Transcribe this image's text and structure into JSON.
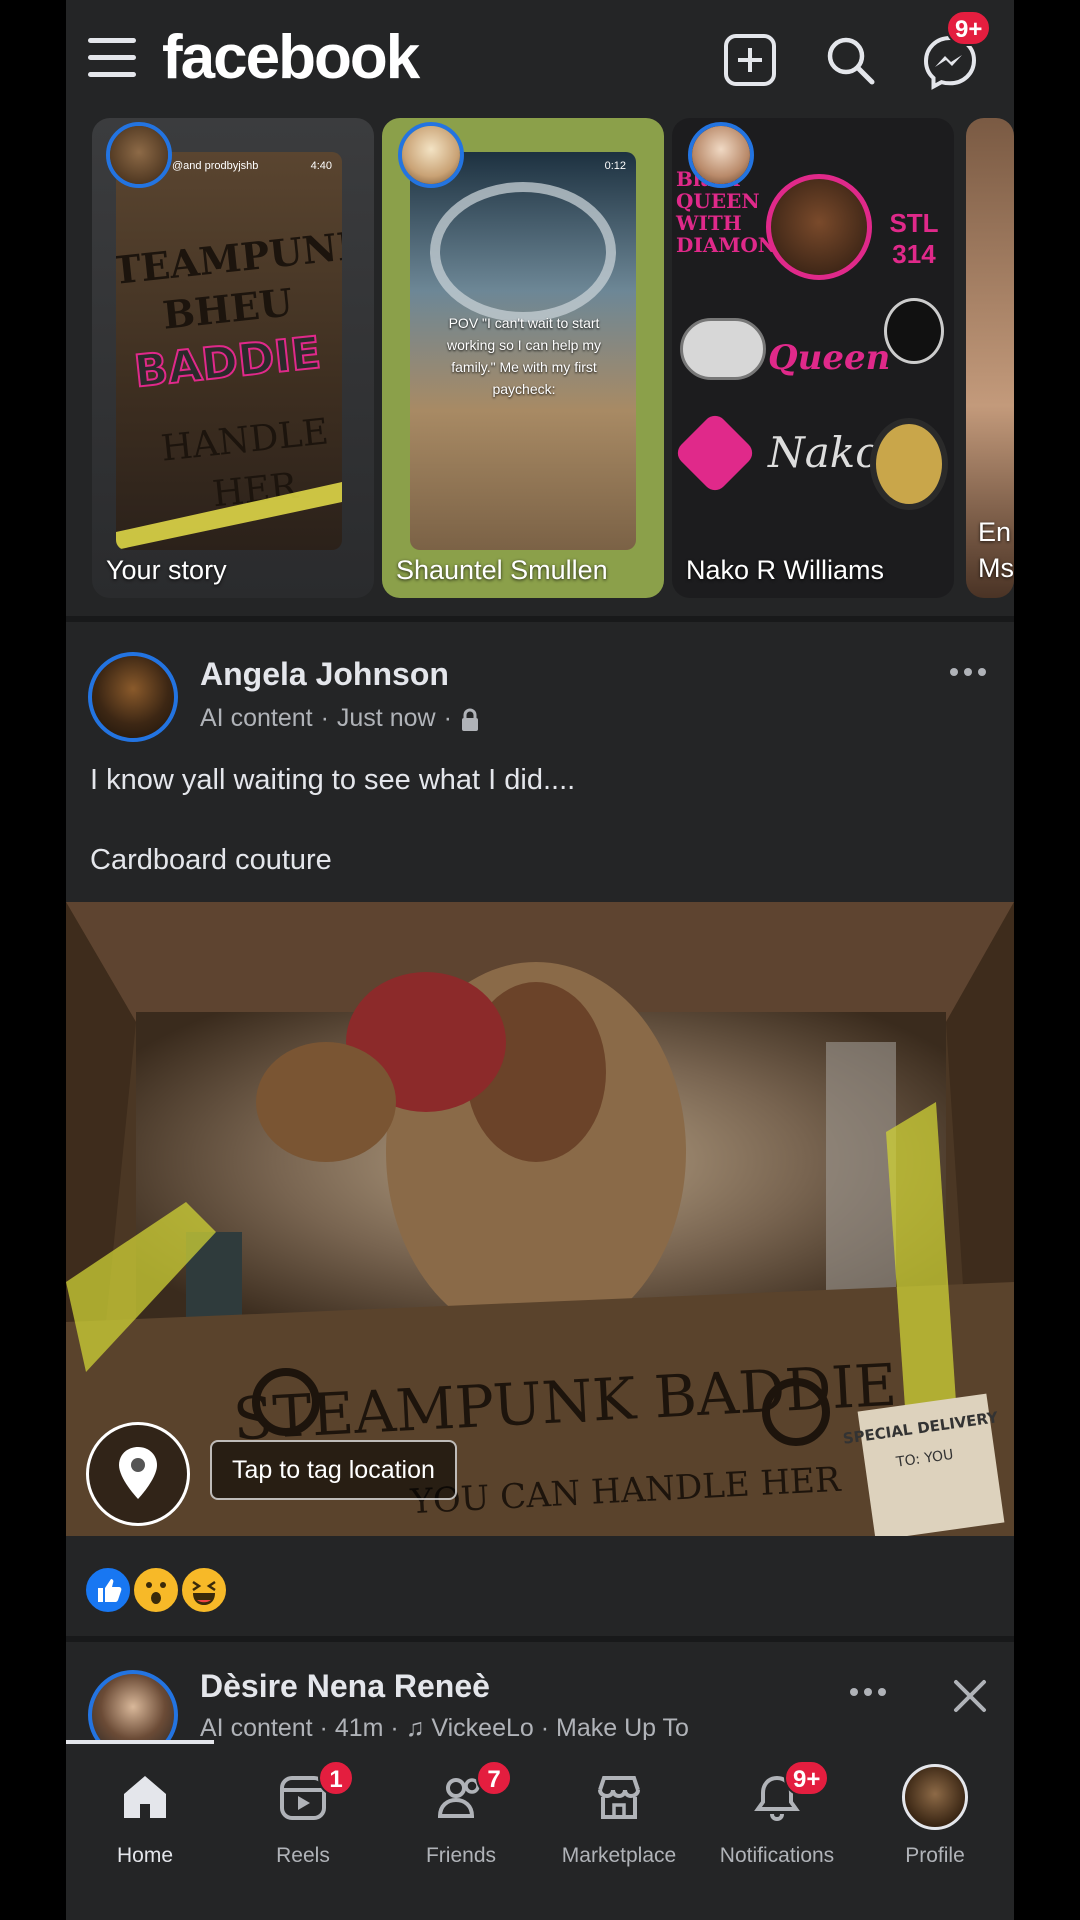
{
  "header": {
    "logo": "facebook",
    "messenger_badge": "9+"
  },
  "stories": [
    {
      "name": "Your story",
      "handle": "@and prodbyjshb",
      "time": "4:40",
      "thumb_title": "STEAMPUNK BHEU BADDIE HANDLE HER"
    },
    {
      "name": "Shauntel Smullen",
      "time": "0:12",
      "caption": "POV \"I can't wait to start working so I can help my family.\" Me with my first paycheck:"
    },
    {
      "name": "Nako R Williams",
      "sticker_texts": [
        "Black QUEEN WITH DIAMONDS",
        "STL 314",
        "Queen",
        "Nako"
      ]
    },
    {
      "name": "En Ms"
    }
  ],
  "post": {
    "author": "Angela Johnson",
    "label": "AI content",
    "time": "Just now",
    "text_line1": "I know yall waiting to see what I did....",
    "text_line2": "Cardboard couture",
    "image_text": "STEAMPUNK BADDIE",
    "image_subtext": "YOU CAN HANDLE HER",
    "box_label": "SPECIAL DELIVERY",
    "box_to": "TO: YOU",
    "tag_location": "Tap to tag location",
    "reactions": [
      "like",
      "wow",
      "haha"
    ]
  },
  "next_post": {
    "author": "Dèsire Nena Reneè",
    "label": "AI content",
    "time": "41m",
    "music": "VickeeLo",
    "song": "Make Up To"
  },
  "nav": [
    {
      "label": "Home",
      "icon": "home-icon",
      "badge": ""
    },
    {
      "label": "Reels",
      "icon": "reels-icon",
      "badge": "1"
    },
    {
      "label": "Friends",
      "icon": "friends-icon",
      "badge": "7"
    },
    {
      "label": "Marketplace",
      "icon": "marketplace-icon",
      "badge": ""
    },
    {
      "label": "Notifications",
      "icon": "bell-icon",
      "badge": "9+"
    },
    {
      "label": "Profile",
      "icon": "profile-avatar",
      "badge": ""
    }
  ],
  "colors": {
    "background": "#242526",
    "accent": "#2374e1",
    "badge": "#e41e3f",
    "text": "#e4e6eb",
    "secondary_text": "#b0b3b8"
  }
}
